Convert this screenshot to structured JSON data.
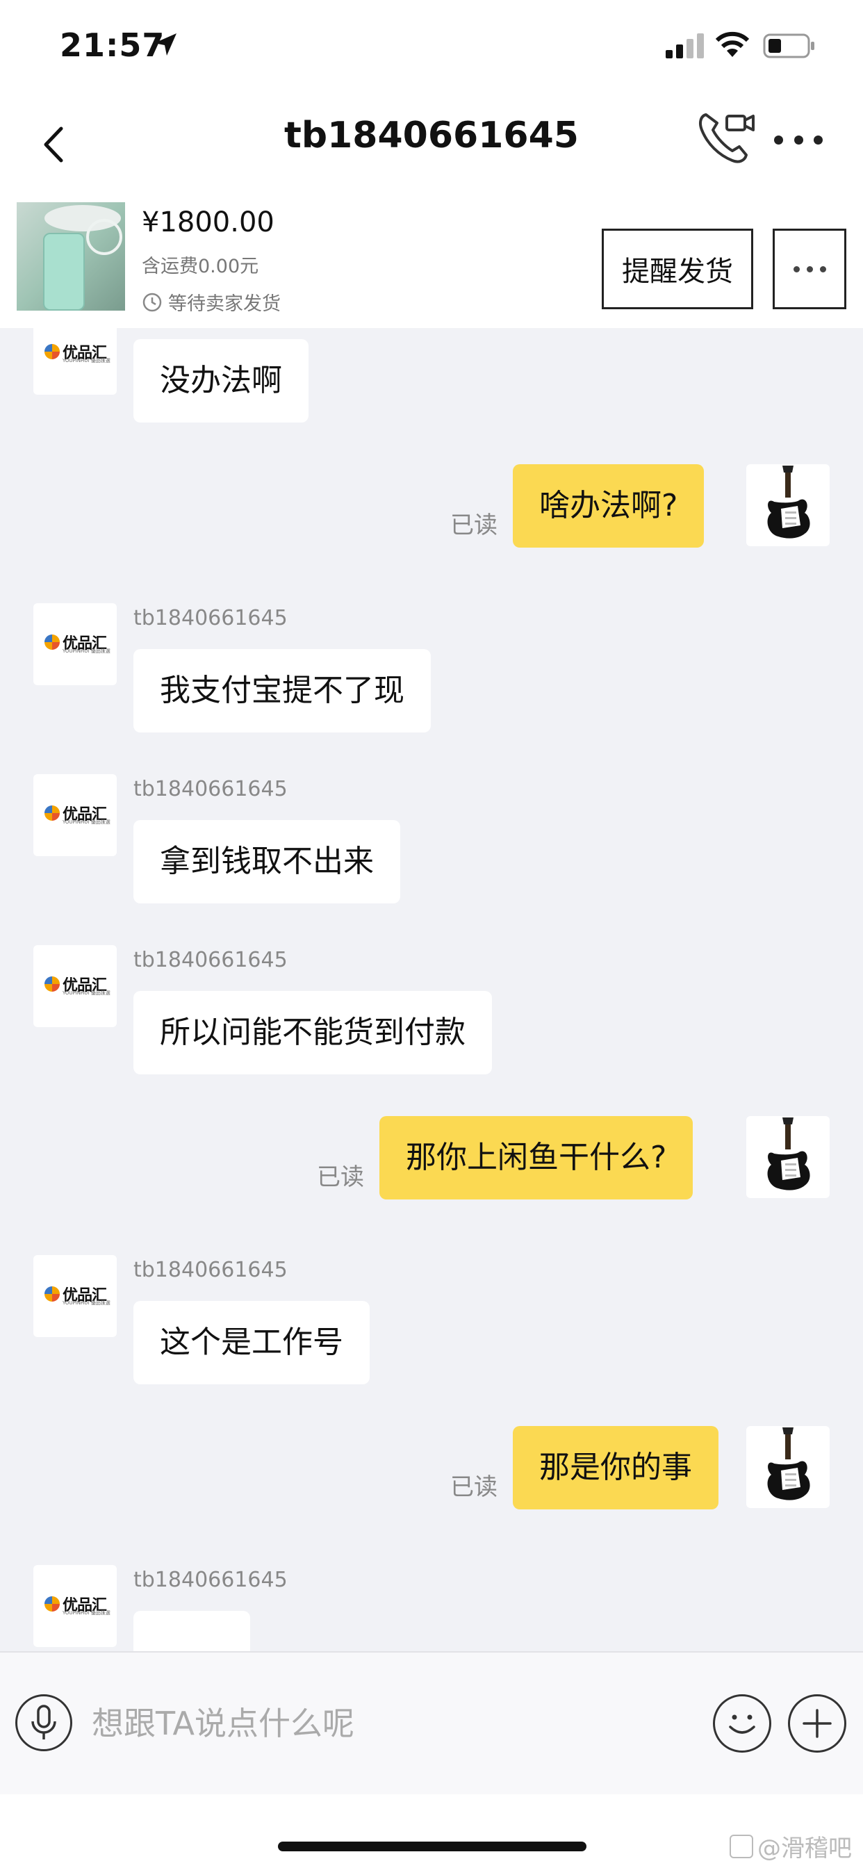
{
  "status_bar": {
    "time": "21:57"
  },
  "header": {
    "title": "tb1840661645"
  },
  "product": {
    "price": "¥1800.00",
    "shipping": "含运费0.00元",
    "status": "等待卖家发货",
    "remind_button": "提醒发货"
  },
  "messages": [
    {
      "side": "in",
      "sender": "",
      "text": "没办法啊"
    },
    {
      "side": "out",
      "read": "已读",
      "text": "啥办法啊?"
    },
    {
      "side": "in",
      "sender": "tb1840661645",
      "text": "我支付宝提不了现"
    },
    {
      "side": "in",
      "sender": "tb1840661645",
      "text": "拿到钱取不出来"
    },
    {
      "side": "in",
      "sender": "tb1840661645",
      "text": "所以问能不能货到付款"
    },
    {
      "side": "out",
      "read": "已读",
      "text": "那你上闲鱼干什么?"
    },
    {
      "side": "in",
      "sender": "tb1840661645",
      "text": "这个是工作号"
    },
    {
      "side": "out",
      "read": "已读",
      "text": "那是你的事"
    },
    {
      "side": "in",
      "sender": "tb1840661645",
      "text": ""
    }
  ],
  "avatar_logo": {
    "name": "优品汇",
    "sub": "YOUPINHUI 優品匯選"
  },
  "input": {
    "placeholder": "想跟TA说点什么呢"
  },
  "watermark": "@滑稽吧",
  "icons": {
    "back": "chevron-left-icon",
    "call": "phone-video-icon",
    "more": "ellipsis-icon",
    "mic": "microphone-icon",
    "emoji": "smiley-icon",
    "plus": "plus-icon"
  },
  "colors": {
    "outgoing_bubble": "#fbd952",
    "chat_background": "#f1f2f6"
  }
}
